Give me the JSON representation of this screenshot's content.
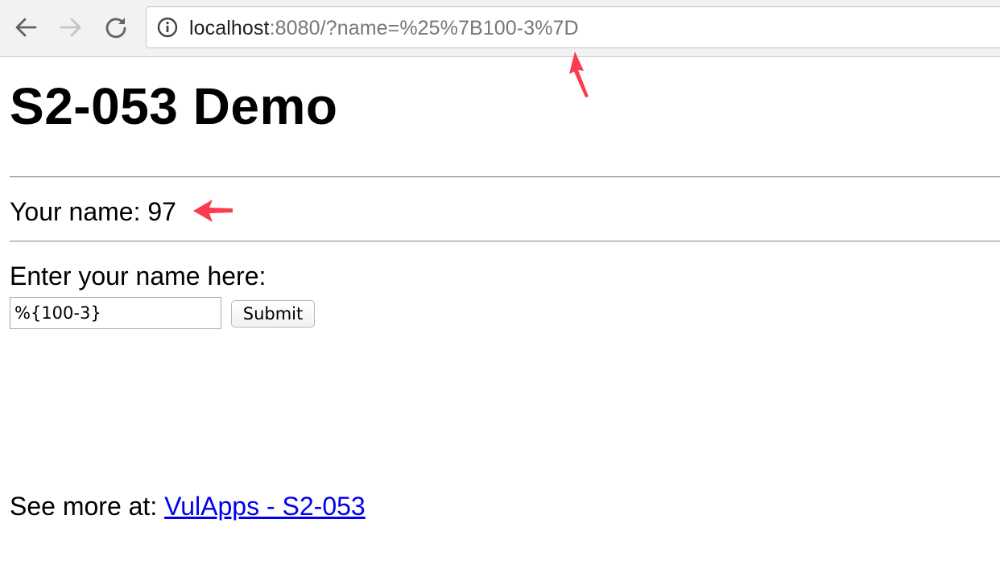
{
  "browser": {
    "url_host": "localhost",
    "url_rest": ":8080/?name=%25%7B100-3%7D",
    "accent_color": "#fb3b4e"
  },
  "page": {
    "title": "S2-053 Demo",
    "name_label": "Your name: ",
    "name_value": "97",
    "prompt": "Enter your name here:",
    "input_value": "%{100-3}",
    "submit_label": "Submit",
    "footer_prefix": "See more at: ",
    "footer_link_text": "VulApps - S2-053",
    "link_color": "#0000ee"
  }
}
